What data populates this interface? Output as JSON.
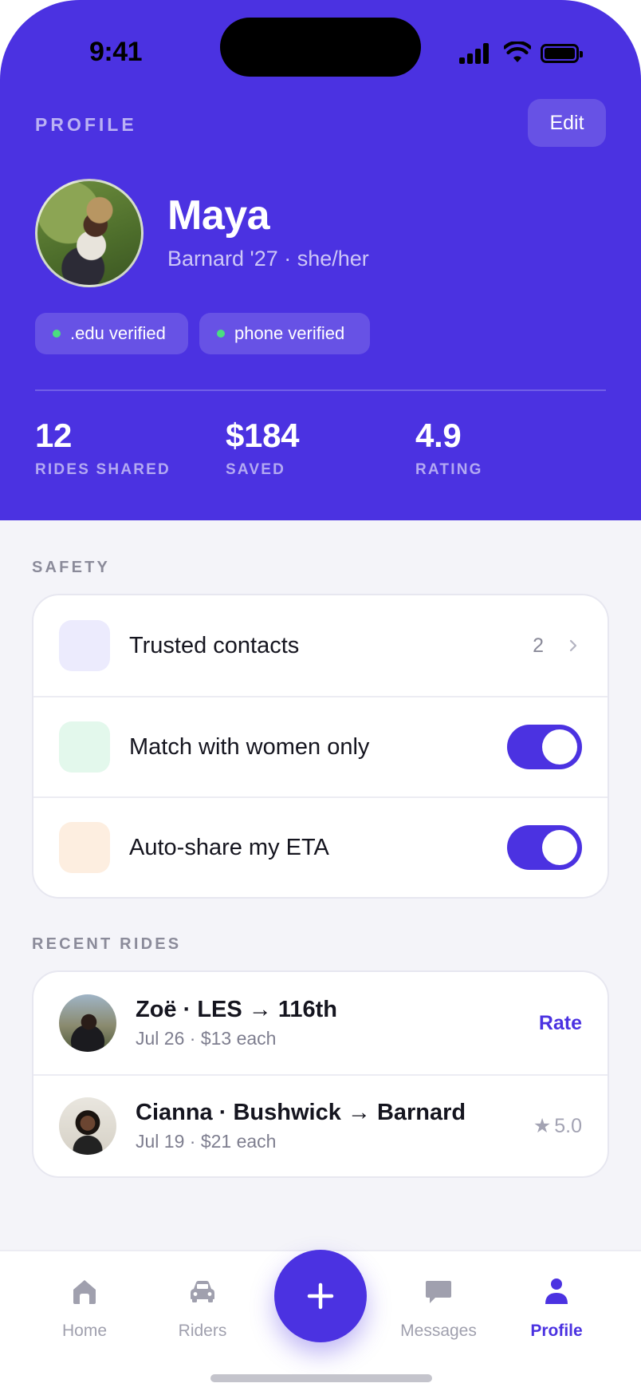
{
  "status_bar": {
    "time": "9:41"
  },
  "header": {
    "label": "PROFILE",
    "edit_label": "Edit",
    "name": "Maya",
    "subtitle": "Barnard '27 · she/her",
    "badges": [
      {
        "text": ".edu verified",
        "color": "#4ade80"
      },
      {
        "text": "phone verified",
        "color": "#4ade80"
      }
    ],
    "stats": [
      {
        "value": "12",
        "label": "RIDES SHARED"
      },
      {
        "value": "$184",
        "label": "SAVED"
      },
      {
        "value": "4.9",
        "label": "RATING"
      }
    ]
  },
  "safety": {
    "label": "SAFETY",
    "items": [
      {
        "text": "Trusted contacts",
        "count": "2",
        "tile_color": "#ecebfd"
      },
      {
        "text": "Match with women only",
        "toggle_on": true,
        "tile_color": "#e3f8ec"
      },
      {
        "text": "Auto-share my ETA",
        "toggle_on": true,
        "tile_color": "#fdeee0"
      }
    ]
  },
  "recent_rides": {
    "label": "RECENT RIDES",
    "items": [
      {
        "title": "Zoë · LES → 116th",
        "subtitle": "Jul 26 · $13 each",
        "action": "Rate"
      },
      {
        "title": "Cianna · Bushwick → Barnard",
        "subtitle": "Jul 19 · $21 each",
        "rating": "5.0",
        "rating_icon": "★"
      }
    ]
  },
  "tabbar": {
    "tabs": [
      {
        "label": "Home",
        "icon": "home-icon"
      },
      {
        "label": "Riders",
        "icon": "car-icon"
      },
      {
        "label": "Messages",
        "icon": "chat-icon"
      },
      {
        "label": "Profile",
        "icon": "person-icon",
        "active": true
      }
    ],
    "fab_icon": "plus-icon"
  },
  "colors": {
    "accent": "#4b32e1",
    "verified_dot": "#4ade80"
  }
}
